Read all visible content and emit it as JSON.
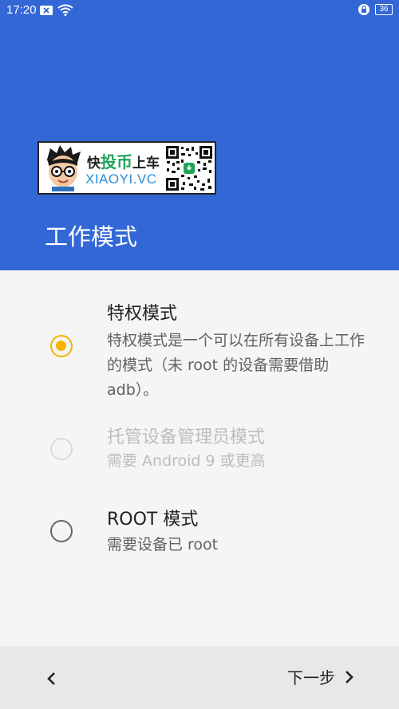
{
  "status_bar": {
    "time": "17:20",
    "battery": "36"
  },
  "ad": {
    "line1_a": "快",
    "line1_b": "投币",
    "line1_c": "上车",
    "line2": "XIAOYI.VC"
  },
  "header": {
    "title": "工作模式"
  },
  "options": [
    {
      "title": "特权模式",
      "description": "特权模式是一个可以在所有设备上工作的模式（未 root 的设备需要借助 adb）。",
      "selected": true,
      "enabled": true
    },
    {
      "title": "托管设备管理员模式",
      "description": "需要 Android 9 或更高",
      "selected": false,
      "enabled": false
    },
    {
      "title": "ROOT 模式",
      "description": "需要设备已 root",
      "selected": false,
      "enabled": true
    }
  ],
  "footer": {
    "next_label": "下一步"
  },
  "colors": {
    "header_bg": "#3367d6",
    "accent": "#f4b400"
  }
}
